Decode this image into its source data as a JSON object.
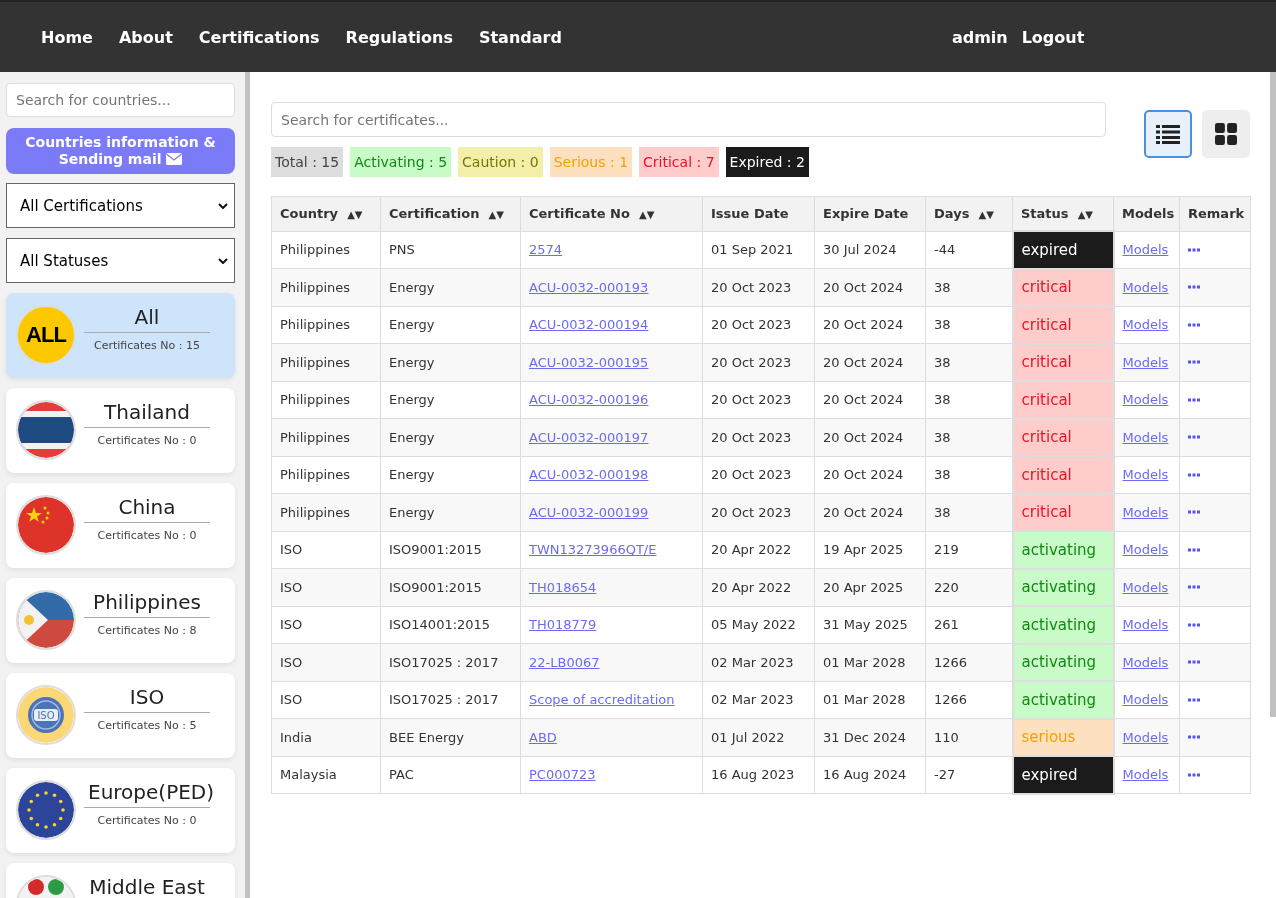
{
  "nav": {
    "links": [
      {
        "label": "Home"
      },
      {
        "label": "About"
      },
      {
        "label": "Certifications"
      },
      {
        "label": "Regulations"
      },
      {
        "label": "Standard"
      }
    ],
    "user": "admin",
    "logout": "Logout"
  },
  "sidebar": {
    "search": {
      "placeholder": "Search for countries..."
    },
    "mail_button": "Countries information & Sending mail",
    "certification_filter": "All Certifications",
    "status_filter": "All Statuses",
    "countries": [
      {
        "kind": "all",
        "name": "All",
        "count": "Certificates No : 15",
        "selected": true,
        "badge": "ALL"
      },
      {
        "kind": "thailand",
        "name": "Thailand",
        "count": "Certificates No : 0",
        "selected": false
      },
      {
        "kind": "china",
        "name": "China",
        "count": "Certificates No : 0",
        "selected": false
      },
      {
        "kind": "philippines",
        "name": "Philippines",
        "count": "Certificates No : 8",
        "selected": false
      },
      {
        "kind": "iso",
        "name": "ISO",
        "count": "Certificates No : 5",
        "selected": false,
        "badge": "ISO"
      },
      {
        "kind": "europe",
        "name": "Europe(PED)",
        "count": "Certificates No : 0",
        "selected": false
      },
      {
        "kind": "middle-east",
        "name": "Middle East",
        "selected": false
      }
    ]
  },
  "search": {
    "placeholder": "Search for certificates..."
  },
  "view_toggle": [
    {
      "kind": "list",
      "selected": true
    },
    {
      "kind": "grid",
      "selected": false
    }
  ],
  "summary": [
    {
      "kind": "total",
      "label": "Total : 15"
    },
    {
      "kind": "activating",
      "label": "Activating : 5"
    },
    {
      "kind": "caution",
      "label": "Caution : 0"
    },
    {
      "kind": "serious",
      "label": "Serious : 1"
    },
    {
      "kind": "critical",
      "label": "Critical : 7"
    },
    {
      "kind": "expired",
      "label": "Expired : 2"
    }
  ],
  "table": {
    "columns": [
      {
        "label": "Country",
        "sort": "▲▼"
      },
      {
        "label": "Certification",
        "sort": "▲▼"
      },
      {
        "label": "Certificate No",
        "sort": "▲▼"
      },
      {
        "label": "Issue Date"
      },
      {
        "label": "Expire Date"
      },
      {
        "label": "Days",
        "sort": "▲▼"
      },
      {
        "label": "Status",
        "sort": "▲▼"
      },
      {
        "label": "Models"
      },
      {
        "label": "Remark"
      }
    ],
    "rows": [
      {
        "country": "Philippines",
        "certification": "PNS",
        "number": "2574",
        "issue": "01 Sep 2021",
        "expire": "30 Jul 2024",
        "days": "-44",
        "status": "expired",
        "models": "Models"
      },
      {
        "country": "Philippines",
        "certification": "Energy",
        "number": "ACU-0032-000193",
        "issue": "20 Oct 2023",
        "expire": "20 Oct 2024",
        "days": "38",
        "status": "critical",
        "models": "Models"
      },
      {
        "country": "Philippines",
        "certification": "Energy",
        "number": "ACU-0032-000194",
        "issue": "20 Oct 2023",
        "expire": "20 Oct 2024",
        "days": "38",
        "status": "critical",
        "models": "Models"
      },
      {
        "country": "Philippines",
        "certification": "Energy",
        "number": "ACU-0032-000195",
        "issue": "20 Oct 2023",
        "expire": "20 Oct 2024",
        "days": "38",
        "status": "critical",
        "models": "Models"
      },
      {
        "country": "Philippines",
        "certification": "Energy",
        "number": "ACU-0032-000196",
        "issue": "20 Oct 2023",
        "expire": "20 Oct 2024",
        "days": "38",
        "status": "critical",
        "models": "Models"
      },
      {
        "country": "Philippines",
        "certification": "Energy",
        "number": "ACU-0032-000197",
        "issue": "20 Oct 2023",
        "expire": "20 Oct 2024",
        "days": "38",
        "status": "critical",
        "models": "Models"
      },
      {
        "country": "Philippines",
        "certification": "Energy",
        "number": "ACU-0032-000198",
        "issue": "20 Oct 2023",
        "expire": "20 Oct 2024",
        "days": "38",
        "status": "critical",
        "models": "Models"
      },
      {
        "country": "Philippines",
        "certification": "Energy",
        "number": "ACU-0032-000199",
        "issue": "20 Oct 2023",
        "expire": "20 Oct 2024",
        "days": "38",
        "status": "critical",
        "models": "Models"
      },
      {
        "country": "ISO",
        "certification": "ISO9001:2015",
        "number": "TWN13273966QT/E",
        "issue": "20 Apr 2022",
        "expire": "19 Apr 2025",
        "days": "219",
        "status": "activating",
        "models": "Models"
      },
      {
        "country": "ISO",
        "certification": "ISO9001:2015",
        "number": "TH018654",
        "issue": "20 Apr 2022",
        "expire": "20 Apr 2025",
        "days": "220",
        "status": "activating",
        "models": "Models"
      },
      {
        "country": "ISO",
        "certification": "ISO14001:2015",
        "number": "TH018779",
        "issue": "05 May 2022",
        "expire": "31 May 2025",
        "days": "261",
        "status": "activating",
        "models": "Models"
      },
      {
        "country": "ISO",
        "certification": "ISO17025 : 2017",
        "number": "22-LB0067",
        "issue": "02 Mar 2023",
        "expire": "01 Mar 2028",
        "days": "1266",
        "status": "activating",
        "models": "Models"
      },
      {
        "country": "ISO",
        "certification": "ISO17025 : 2017",
        "number": "Scope of accreditation",
        "issue": "02 Mar 2023",
        "expire": "01 Mar 2028",
        "days": "1266",
        "status": "activating",
        "models": "Models"
      },
      {
        "country": "India",
        "certification": "BEE Energy",
        "number": "ABD",
        "issue": "01 Jul 2022",
        "expire": "31 Dec 2024",
        "days": "110",
        "status": "serious",
        "models": "Models"
      },
      {
        "country": "Malaysia",
        "certification": "PAC",
        "number": "PC000723",
        "issue": "16 Aug 2023",
        "expire": "16 Aug 2024",
        "days": "-27",
        "status": "expired",
        "models": "Models"
      }
    ]
  }
}
